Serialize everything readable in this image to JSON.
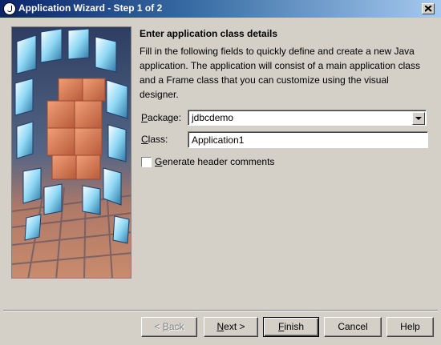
{
  "window": {
    "title": "Application Wizard - Step 1 of 2"
  },
  "content": {
    "heading": "Enter application class details",
    "description": "Fill in the following fields to quickly define and create a new Java application. The application will consist of a main application class and a Frame class that you can customize using the visual designer."
  },
  "form": {
    "package": {
      "label_key": "P",
      "label_rest": "ackage:",
      "value": "jdbcdemo"
    },
    "class": {
      "label_key": "C",
      "label_rest": "lass:",
      "value": "Application1"
    },
    "header_comments": {
      "label_key": "G",
      "label_rest": "enerate header comments",
      "checked": false
    }
  },
  "buttons": {
    "back": {
      "pre": "< ",
      "key": "B",
      "post": "ack",
      "enabled": false
    },
    "next": {
      "pre": "",
      "key": "N",
      "post": "ext >",
      "enabled": true
    },
    "finish": {
      "pre": "",
      "key": "F",
      "post": "inish",
      "enabled": true
    },
    "cancel": {
      "label": "Cancel"
    },
    "help": {
      "label": "Help"
    }
  },
  "colors": {
    "face": "#d4d0c8",
    "title_start": "#0a246a",
    "title_end": "#a6caf0"
  }
}
